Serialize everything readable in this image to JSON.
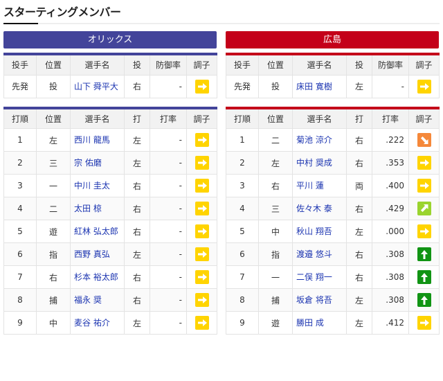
{
  "title": "スターティングメンバー",
  "colors": {
    "orix": "#43449a",
    "hiroshima": "#c4001a",
    "flat": "#ffd400",
    "down": "#f5883a",
    "upright": "#9ad42e",
    "up": "#119414"
  },
  "teams": [
    {
      "key": "orix",
      "name": "オリックス",
      "pitcher_headers": [
        "投手",
        "位置",
        "選手名",
        "投",
        "防御率",
        "調子"
      ],
      "pitchers": [
        {
          "role": "先発",
          "pos": "投",
          "name": "山下 舜平大",
          "hand": "右",
          "avg": "-",
          "cond": "flat"
        }
      ],
      "batter_headers": [
        "打順",
        "位置",
        "選手名",
        "打",
        "打率",
        "調子"
      ],
      "batters": [
        {
          "order": "1",
          "pos": "左",
          "name": "西川 龍馬",
          "hand": "左",
          "avg": "-",
          "cond": "flat"
        },
        {
          "order": "2",
          "pos": "三",
          "name": "宗 佑磨",
          "hand": "左",
          "avg": "-",
          "cond": "flat"
        },
        {
          "order": "3",
          "pos": "一",
          "name": "中川 圭太",
          "hand": "右",
          "avg": "-",
          "cond": "flat"
        },
        {
          "order": "4",
          "pos": "二",
          "name": "太田 椋",
          "hand": "右",
          "avg": "-",
          "cond": "flat"
        },
        {
          "order": "5",
          "pos": "遊",
          "name": "紅林 弘太郎",
          "hand": "右",
          "avg": "-",
          "cond": "flat"
        },
        {
          "order": "6",
          "pos": "指",
          "name": "西野 真弘",
          "hand": "左",
          "avg": "-",
          "cond": "flat"
        },
        {
          "order": "7",
          "pos": "右",
          "name": "杉本 裕太郎",
          "hand": "右",
          "avg": "-",
          "cond": "flat"
        },
        {
          "order": "8",
          "pos": "捕",
          "name": "福永 奨",
          "hand": "右",
          "avg": "-",
          "cond": "flat"
        },
        {
          "order": "9",
          "pos": "中",
          "name": "麦谷 祐介",
          "hand": "左",
          "avg": "-",
          "cond": "flat"
        }
      ]
    },
    {
      "key": "hiroshima",
      "name": "広島",
      "pitcher_headers": [
        "投手",
        "位置",
        "選手名",
        "投",
        "防御率",
        "調子"
      ],
      "pitchers": [
        {
          "role": "先発",
          "pos": "投",
          "name": "床田 寛樹",
          "hand": "左",
          "avg": "-",
          "cond": "flat"
        }
      ],
      "batter_headers": [
        "打順",
        "位置",
        "選手名",
        "打",
        "打率",
        "調子"
      ],
      "batters": [
        {
          "order": "1",
          "pos": "二",
          "name": "菊池 涼介",
          "hand": "右",
          "avg": ".222",
          "cond": "down"
        },
        {
          "order": "2",
          "pos": "左",
          "name": "中村 奨成",
          "hand": "右",
          "avg": ".353",
          "cond": "flat"
        },
        {
          "order": "3",
          "pos": "右",
          "name": "平川 蓮",
          "hand": "両",
          "avg": ".400",
          "cond": "flat"
        },
        {
          "order": "4",
          "pos": "三",
          "name": "佐々木 泰",
          "hand": "右",
          "avg": ".429",
          "cond": "upright"
        },
        {
          "order": "5",
          "pos": "中",
          "name": "秋山 翔吾",
          "hand": "左",
          "avg": ".000",
          "cond": "flat"
        },
        {
          "order": "6",
          "pos": "指",
          "name": "渡邉 悠斗",
          "hand": "右",
          "avg": ".308",
          "cond": "up"
        },
        {
          "order": "7",
          "pos": "一",
          "name": "二俣 翔一",
          "hand": "右",
          "avg": ".308",
          "cond": "up"
        },
        {
          "order": "8",
          "pos": "捕",
          "name": "坂倉 将吾",
          "hand": "左",
          "avg": ".308",
          "cond": "up"
        },
        {
          "order": "9",
          "pos": "遊",
          "name": "勝田 成",
          "hand": "左",
          "avg": ".412",
          "cond": "flat"
        }
      ]
    }
  ]
}
